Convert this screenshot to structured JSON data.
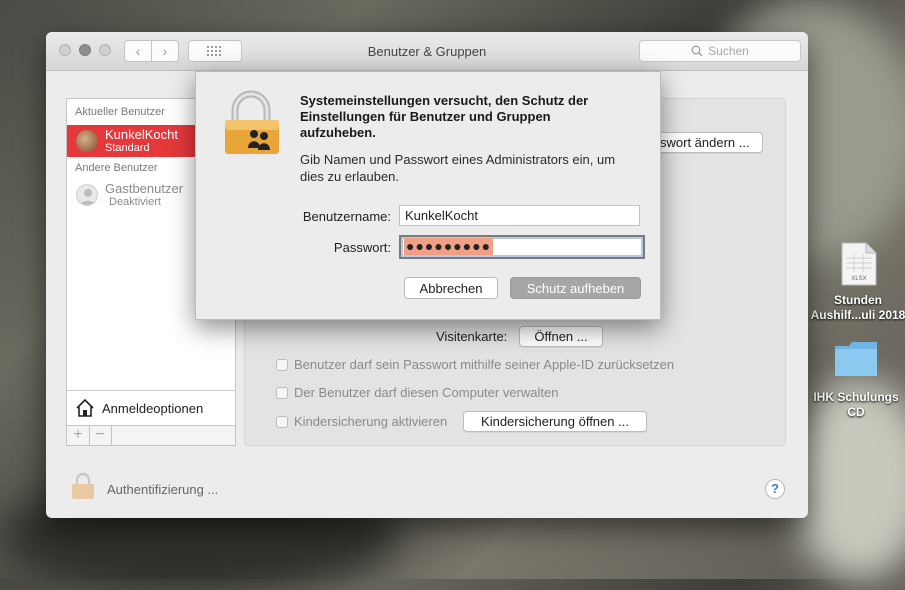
{
  "window": {
    "title": "Benutzer & Gruppen",
    "search_placeholder": "Suchen",
    "nav_back": "‹",
    "nav_forward": "›",
    "grid_icon": "grid-icon"
  },
  "sidebar": {
    "current_header": "Aktueller Benutzer",
    "current_user": {
      "name": "KunkelKocht",
      "role": "Standard"
    },
    "other_header": "Andere Benutzer",
    "guest": {
      "name": "Gastbenutzer",
      "status": "Deaktiviert"
    },
    "login_options": "Anmeldeoptionen",
    "add": "+",
    "remove": "−"
  },
  "panel": {
    "change_password": "swort ändern ...",
    "card_label": "Visitenkarte:",
    "card_open": "Öffnen ...",
    "options": [
      "Benutzer darf sein Passwort mithilfe seiner Apple-ID zurücksetzen",
      "Der Benutzer darf diesen Computer verwalten",
      "Kindersicherung aktivieren"
    ],
    "parental_open": "Kindersicherung öffnen ..."
  },
  "footer": {
    "auth": "Authentifizierung ...",
    "help": "?"
  },
  "dialog": {
    "title": "Systemeinstellungen versucht, den Schutz der Einstellungen für Benutzer und Gruppen aufzuheben.",
    "body": "Gib Namen und Passwort eines Administrators ein, um dies zu erlauben.",
    "username_label": "Benutzername:",
    "username_value": "KunkelKocht",
    "password_label": "Passwort:",
    "password_mask": "●●●●●●●●●",
    "cancel": "Abbrechen",
    "unlock": "Schutz aufheben"
  },
  "desktop": {
    "file_label": "Stunden Aushilf...uli 2018",
    "file_type": "XLSX",
    "folder_label": "IHK Schulungs CD"
  },
  "colors": {
    "selection": "#e6383b",
    "password_highlight": "#f2a085"
  }
}
